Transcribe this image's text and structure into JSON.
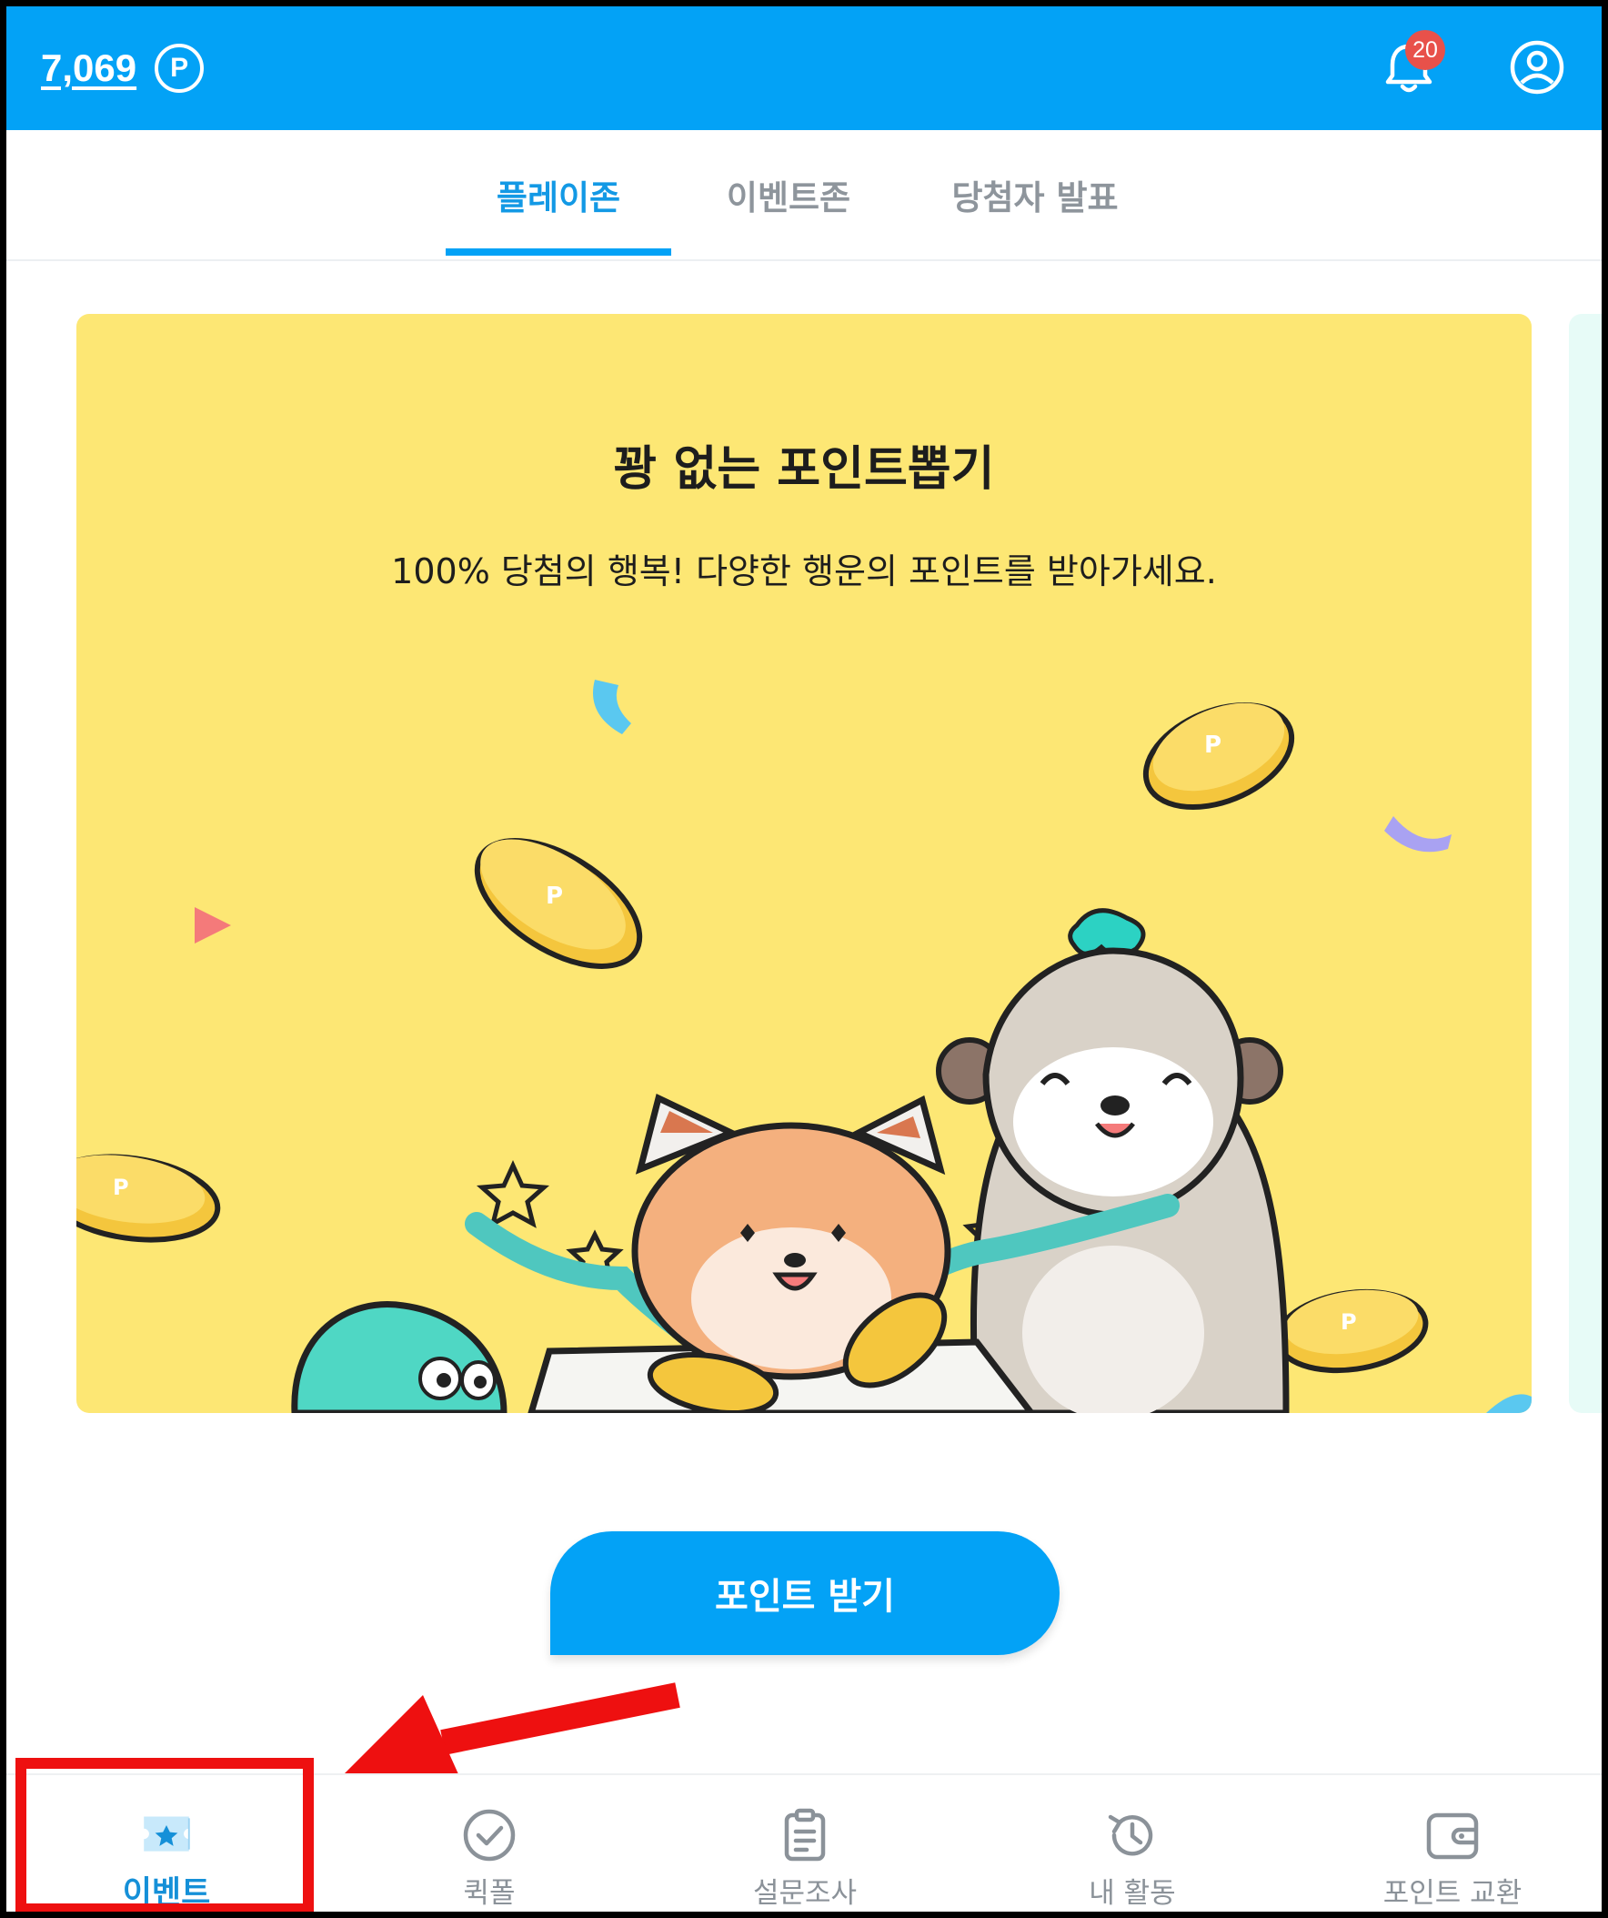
{
  "header": {
    "points_value": "7,069",
    "points_unit": "P",
    "notification_count": "20"
  },
  "tabs": [
    {
      "label": "플레이존",
      "active": true
    },
    {
      "label": "이벤트존",
      "active": false
    },
    {
      "label": "당첨자 발표",
      "active": false
    }
  ],
  "banner": {
    "title": "꽝 없는 포인트뽑기",
    "subtitle": "100% 당첨의 행복! 다양한 행운의 포인트를 받아가세요."
  },
  "cta": {
    "label": "포인트 받기"
  },
  "bottom_nav": [
    {
      "label": "이벤트",
      "icon": "event-ticket-icon",
      "active": true
    },
    {
      "label": "퀵폴",
      "icon": "check-circle-icon",
      "active": false
    },
    {
      "label": "설문조사",
      "icon": "clipboard-icon",
      "active": false
    },
    {
      "label": "내 활동",
      "icon": "history-icon",
      "active": false
    },
    {
      "label": "포인트 교환",
      "icon": "wallet-icon",
      "active": false
    }
  ],
  "colors": {
    "primary": "#03a2f6",
    "banner_bg": "#fde774",
    "badge": "#e8514a",
    "annotation": "#ee1010"
  }
}
